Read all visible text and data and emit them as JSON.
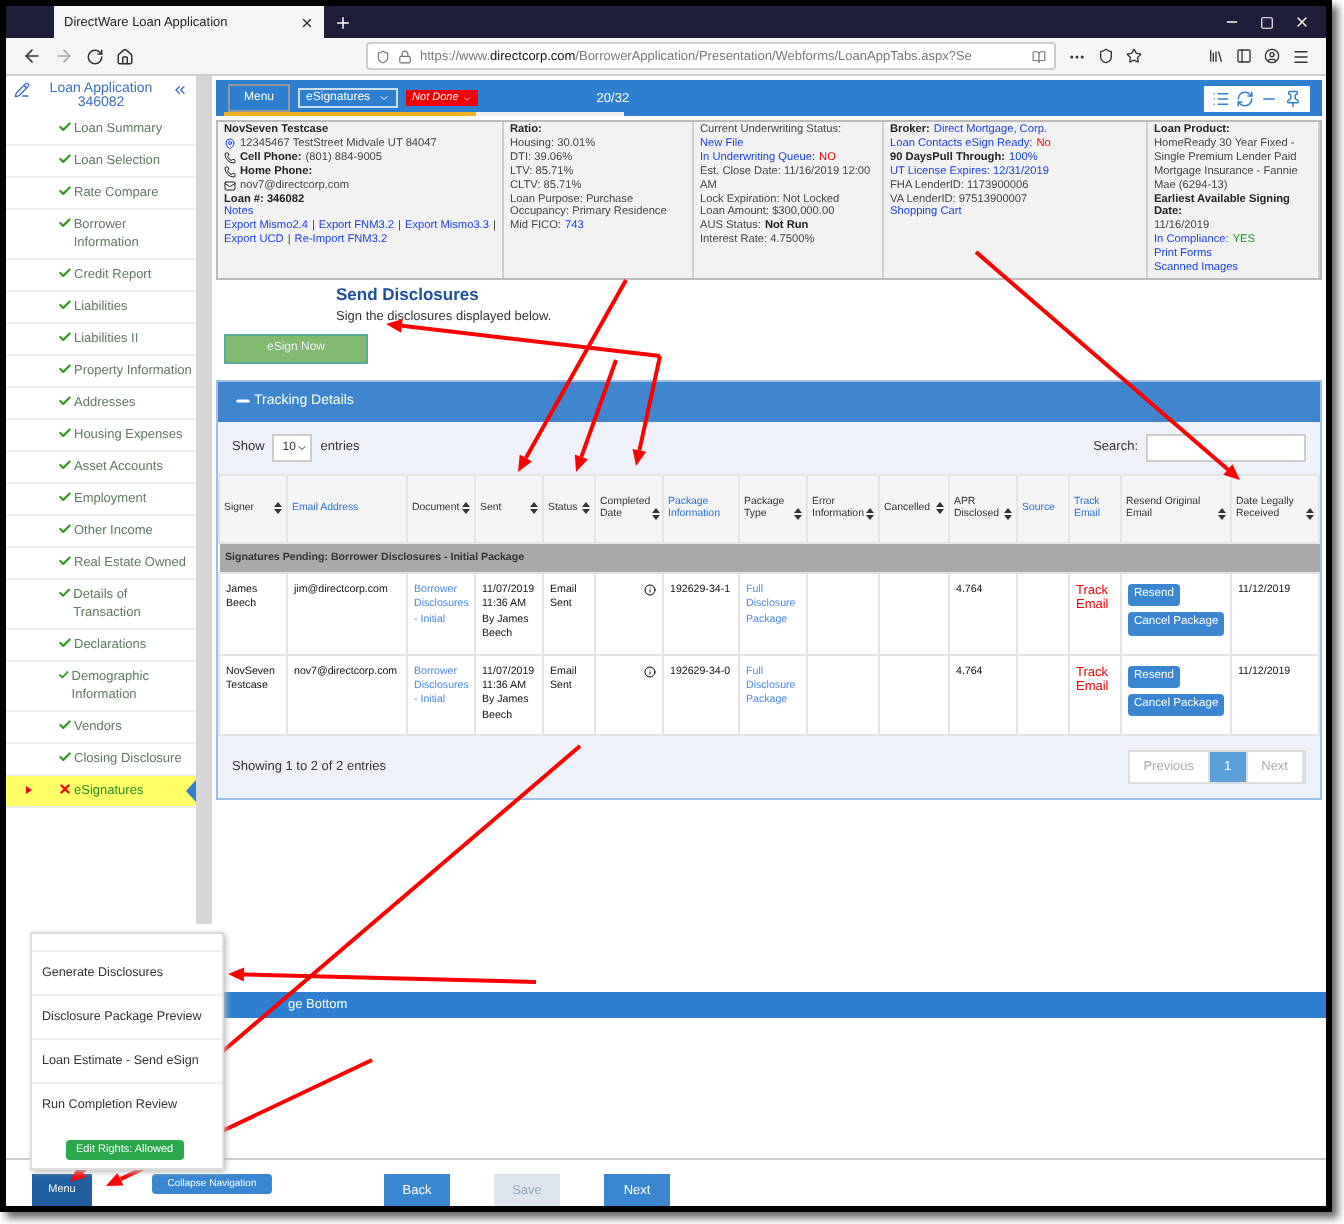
{
  "browser": {
    "tab_title": "DirectWare Loan Application",
    "url_prefix": "https://www.",
    "url_domain": "directcorp.com",
    "url_path": "/BorrowerApplication/Presentation/Webforms/LoanAppTabs.aspx?Se"
  },
  "sidebar": {
    "title": "Loan Application",
    "loan_number": "346082",
    "items": [
      {
        "label": "Loan Summary",
        "kind": "done",
        "selected": false
      },
      {
        "label": "Loan Selection",
        "kind": "done",
        "selected": false
      },
      {
        "label": "Rate Compare",
        "kind": "done",
        "selected": false
      },
      {
        "label": "Borrower Information",
        "kind": "done",
        "selected": false
      },
      {
        "label": "Credit Report",
        "kind": "done",
        "selected": false
      },
      {
        "label": "Liabilities",
        "kind": "done",
        "selected": false
      },
      {
        "label": "Liabilities II",
        "kind": "done",
        "selected": false
      },
      {
        "label": "Property Information",
        "kind": "done",
        "selected": false
      },
      {
        "label": "Addresses",
        "kind": "done",
        "selected": false
      },
      {
        "label": "Housing Expenses",
        "kind": "done",
        "selected": false
      },
      {
        "label": "Asset Accounts",
        "kind": "done",
        "selected": false
      },
      {
        "label": "Employment",
        "kind": "done",
        "selected": false
      },
      {
        "label": "Other Income",
        "kind": "done",
        "selected": false
      },
      {
        "label": "Real Estate Owned",
        "kind": "done",
        "selected": false
      },
      {
        "label": "Details of Transaction",
        "kind": "done",
        "selected": false
      },
      {
        "label": "Declarations",
        "kind": "done",
        "selected": false
      },
      {
        "label": "Demographic Information",
        "kind": "done",
        "selected": false
      },
      {
        "label": "Vendors",
        "kind": "done",
        "selected": false
      },
      {
        "label": "Closing Disclosure",
        "kind": "done",
        "selected": false
      },
      {
        "label": "eSignatures",
        "kind": "error",
        "selected": true
      }
    ]
  },
  "top_bar": {
    "menu": "Menu",
    "section": "eSignatures",
    "status_badge": "Not Done",
    "progress_text": "20/32",
    "level": 0.63
  },
  "info_columns": [
    [
      {
        "parts": [
          {
            "text": "NovSeven Testcase",
            "kind": "bold"
          }
        ]
      },
      {
        "kind": "pin",
        "parts": [
          {
            "text": "12345467 TestStreet Midvale UT 84047",
            "kind": "plain"
          }
        ]
      },
      {
        "kind": "phone",
        "parts": [
          {
            "text": "Cell Phone:",
            "kind": "bold"
          },
          {
            "text": "(801) 884-9005",
            "kind": "plain"
          }
        ]
      },
      {
        "kind": "phone",
        "parts": [
          {
            "text": "Home Phone:",
            "kind": "bold"
          }
        ]
      },
      {
        "kind": "mail",
        "parts": [
          {
            "text": "nov7@directcorp.com",
            "kind": "plain"
          }
        ]
      },
      {
        "parts": [
          {
            "text": "Loan #: 346082",
            "kind": "bold"
          }
        ]
      },
      {
        "parts": [
          {
            "text": "Notes",
            "kind": "link"
          }
        ]
      },
      {
        "parts": [
          {
            "text": "Export Mismo2.4",
            "kind": "link"
          },
          {
            "text": "|",
            "kind": "plain"
          },
          {
            "text": "Export FNM3.2",
            "kind": "link"
          },
          {
            "text": "|",
            "kind": "plain"
          },
          {
            "text": "Export Mismo3.3",
            "kind": "link"
          },
          {
            "text": "|",
            "kind": "plain"
          },
          {
            "text": "Export UCD",
            "kind": "link"
          },
          {
            "text": "|",
            "kind": "plain"
          },
          {
            "text": "Re-Import FNM3.2",
            "kind": "link"
          }
        ]
      }
    ],
    [
      {
        "parts": [
          {
            "text": "Ratio:",
            "kind": "bold"
          }
        ]
      },
      {
        "parts": [
          {
            "text": "Housing: 30.01%",
            "kind": "plain"
          }
        ]
      },
      {
        "parts": [
          {
            "text": "DTI: 39.06%",
            "kind": "plain"
          }
        ]
      },
      {
        "parts": [
          {
            "text": "LTV: 85.71%",
            "kind": "plain"
          }
        ]
      },
      {
        "parts": [
          {
            "text": "CLTV: 85.71%",
            "kind": "plain"
          }
        ]
      },
      {
        "parts": [
          {
            "text": "Loan Purpose: Purchase",
            "kind": "plain"
          }
        ]
      },
      {
        "parts": [
          {
            "text": "Occupancy: Primary Residence",
            "kind": "plain"
          }
        ]
      },
      {
        "parts": [
          {
            "text": "Mid FICO:",
            "kind": "plain"
          },
          {
            "text": "743",
            "kind": "link"
          }
        ]
      }
    ],
    [
      {
        "parts": [
          {
            "text": "Current Underwriting Status:",
            "kind": "plain"
          },
          {
            "text": "New File",
            "kind": "link"
          }
        ]
      },
      {
        "parts": [
          {
            "text": "In Underwriting Queue:",
            "kind": "link"
          },
          {
            "text": "NO",
            "kind": "alert"
          }
        ]
      },
      {
        "parts": [
          {
            "text": "Est. Close Date: 11/16/2019 12:00 AM",
            "kind": "plain"
          }
        ]
      },
      {
        "parts": [
          {
            "text": "Lock Expiration: Not Locked",
            "kind": "plain"
          }
        ]
      },
      {
        "parts": [
          {
            "text": "Loan Amount: $300,000.00",
            "kind": "plain"
          }
        ]
      },
      {
        "parts": [
          {
            "text": "AUS Status:",
            "kind": "plain"
          },
          {
            "text": "Not Run",
            "kind": "bold"
          }
        ]
      },
      {
        "parts": [
          {
            "text": "Interest Rate: 4.7500%",
            "kind": "plain"
          }
        ]
      }
    ],
    [
      {
        "parts": [
          {
            "text": "Broker:",
            "kind": "bold"
          },
          {
            "text": "Direct Mortgage, Corp.",
            "kind": "link"
          }
        ]
      },
      {
        "parts": [
          {
            "text": "Loan Contacts eSign Ready:",
            "kind": "link"
          },
          {
            "text": "No",
            "kind": "alert"
          }
        ]
      },
      {
        "parts": [
          {
            "text": "90 DaysPull Through:",
            "kind": "bold"
          },
          {
            "text": "100%",
            "kind": "link"
          }
        ]
      },
      {
        "parts": [
          {
            "text": "UT License Expires: 12/31/2019",
            "kind": "link"
          }
        ]
      },
      {
        "parts": [
          {
            "text": "FHA LenderID: 1173900006",
            "kind": "plain"
          }
        ]
      },
      {
        "parts": [
          {
            "text": "VA LenderID: 97513900007",
            "kind": "plain"
          }
        ]
      },
      {
        "parts": [
          {
            "text": "Shopping Cart",
            "kind": "link"
          }
        ]
      }
    ],
    [
      {
        "parts": [
          {
            "text": "Loan Product:",
            "kind": "bold"
          }
        ]
      },
      {
        "parts": [
          {
            "text": "HomeReady 30 Year Fixed - Single Premium Lender Paid Mortgage Insurance - Fannie Mae (6294-13)",
            "kind": "plain"
          }
        ]
      },
      {
        "parts": [
          {
            "text": "Earliest Available Signing Date:",
            "kind": "bold"
          }
        ]
      },
      {
        "parts": [
          {
            "text": "11/16/2019",
            "kind": "plain"
          }
        ]
      },
      {
        "parts": [
          {
            "text": "In Compliance:",
            "kind": "link"
          },
          {
            "text": "YES",
            "kind": "ok"
          }
        ]
      },
      {
        "parts": [
          {
            "text": "Print Forms",
            "kind": "link"
          }
        ]
      },
      {
        "parts": [
          {
            "text": "Scanned Images",
            "kind": "link"
          }
        ]
      }
    ]
  ],
  "disclosures": {
    "title": "Send Disclosures",
    "subtitle": "Sign the disclosures displayed below.",
    "button": "eSign Now"
  },
  "tracking": {
    "title": "Tracking Details",
    "show_label": "Show",
    "page_size": "10",
    "entries_label": "entries",
    "search_label": "Search:",
    "columns": [
      {
        "label": "Signer",
        "link": false,
        "sortable": true
      },
      {
        "label": "Email Address",
        "link": true,
        "sortable": false
      },
      {
        "label": "Document",
        "link": false,
        "sortable": true
      },
      {
        "label": "Sent",
        "link": false,
        "sortable": true
      },
      {
        "label": "Status",
        "link": false,
        "sortable": true
      },
      {
        "label": "Completed Date",
        "link": false,
        "sortable": true
      },
      {
        "label": "Package Information",
        "link": true,
        "sortable": false
      },
      {
        "label": "Package Type",
        "link": false,
        "sortable": true
      },
      {
        "label": "Error Information",
        "link": false,
        "sortable": true
      },
      {
        "label": "Cancelled",
        "link": false,
        "sortable": true
      },
      {
        "label": "APR Disclosed",
        "link": false,
        "sortable": true
      },
      {
        "label": "Source",
        "link": true,
        "sortable": false
      },
      {
        "label": "Track Email",
        "link": true,
        "sortable": false
      },
      {
        "label": "Resend Original Email",
        "link": false,
        "sortable": true
      },
      {
        "label": "Date Legally Received",
        "link": false,
        "sortable": true
      }
    ],
    "group": "Signatures Pending: Borrower Disclosures - Initial Package",
    "rows": [
      {
        "cells": [
          {
            "kind": "text",
            "text": "James Beech"
          },
          {
            "kind": "text",
            "text": "jim@directcorp.com"
          },
          {
            "kind": "link",
            "text": "Borrower Disclosures - Initial"
          },
          {
            "kind": "text",
            "text": "11/07/2019 11:36 AM By James Beech"
          },
          {
            "kind": "text",
            "text": "Email Sent"
          },
          {
            "kind": "info"
          },
          {
            "kind": "text",
            "text": "192629-34-1"
          },
          {
            "kind": "link",
            "text": "Full Disclosure Package"
          },
          {
            "kind": "empty"
          },
          {
            "kind": "empty"
          },
          {
            "kind": "text",
            "text": "4.764"
          },
          {
            "kind": "empty"
          },
          {
            "kind": "alert",
            "text": "Track Email"
          },
          {
            "kind": "actions",
            "buttons": [
              "Resend",
              "Cancel Package"
            ]
          },
          {
            "kind": "text",
            "text": "11/12/2019"
          }
        ]
      },
      {
        "cells": [
          {
            "kind": "text",
            "text": "NovSeven Testcase"
          },
          {
            "kind": "text",
            "text": "nov7@directcorp.com"
          },
          {
            "kind": "link",
            "text": "Borrower Disclosures - Initial"
          },
          {
            "kind": "text",
            "text": "11/07/2019 11:36 AM By James Beech"
          },
          {
            "kind": "text",
            "text": "Email Sent"
          },
          {
            "kind": "info"
          },
          {
            "kind": "text",
            "text": "192629-34-0"
          },
          {
            "kind": "link",
            "text": "Full Disclosure Package"
          },
          {
            "kind": "empty"
          },
          {
            "kind": "empty"
          },
          {
            "kind": "text",
            "text": "4.764"
          },
          {
            "kind": "empty"
          },
          {
            "kind": "alert",
            "text": "Track Email"
          },
          {
            "kind": "actions",
            "buttons": [
              "Resend",
              "Cancel Package"
            ]
          },
          {
            "kind": "text",
            "text": "11/12/2019"
          }
        ]
      }
    ],
    "summary": "Showing 1 to 2 of 2 entries",
    "pager": [
      {
        "label": "Previous",
        "selected": false
      },
      {
        "label": "1",
        "selected": true
      },
      {
        "label": "Next",
        "selected": false
      }
    ]
  },
  "page_bottom": "ge Bottom",
  "popup_menu": {
    "items": [
      "Generate Disclosures",
      "Disclosure Package Preview",
      "Loan Estimate - Send eSign",
      "Run Completion Review"
    ],
    "badge": "Edit Rights: Allowed"
  },
  "bottom_bar": [
    {
      "label": "Menu",
      "kind": "menu",
      "disabled": false
    },
    {
      "label": "Collapse Navigation",
      "kind": "small",
      "disabled": false
    },
    {
      "label": "Back",
      "kind": "nav",
      "disabled": false
    },
    {
      "label": "Save",
      "kind": "nav",
      "disabled": true
    },
    {
      "label": "Next",
      "kind": "nav",
      "disabled": false
    }
  ]
}
